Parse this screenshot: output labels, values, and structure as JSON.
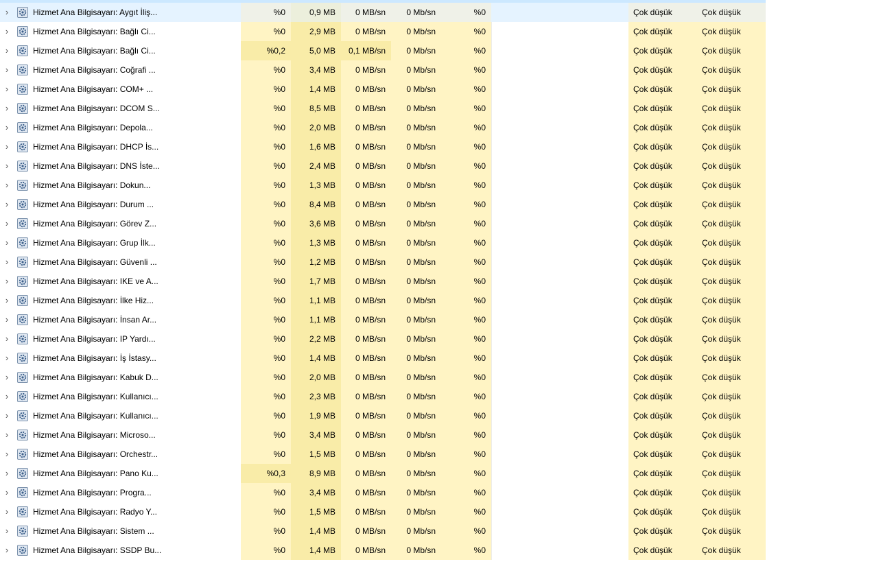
{
  "colors": {
    "accent": "#cce8ff",
    "heat_low": "#fff4c4",
    "heat_mid": "#f9eca8"
  },
  "rows": [
    {
      "name": "Hizmet Ana Bilgisayarı: Aygıt İliş...",
      "cpu": "%0",
      "mem": "0,9 MB",
      "disk": "0 MB/sn",
      "net": "0 Mb/sn",
      "gpu": "%0",
      "power": "Çok düşük",
      "power_trend": "Çok düşük",
      "selected": true
    },
    {
      "name": "Hizmet Ana Bilgisayarı: Bağlı Ci...",
      "cpu": "%0",
      "mem": "2,9 MB",
      "disk": "0 MB/sn",
      "net": "0 Mb/sn",
      "gpu": "%0",
      "power": "Çok düşük",
      "power_trend": "Çok düşük"
    },
    {
      "name": "Hizmet Ana Bilgisayarı: Bağlı Ci...",
      "cpu": "%0,2",
      "mem": "5,0 MB",
      "disk": "0,1 MB/sn",
      "net": "0 Mb/sn",
      "gpu": "%0",
      "power": "Çok düşük",
      "power_trend": "Çok düşük",
      "cpu_hot": true,
      "disk_hot": true
    },
    {
      "name": "Hizmet Ana Bilgisayarı: Coğrafi ...",
      "cpu": "%0",
      "mem": "3,4 MB",
      "disk": "0 MB/sn",
      "net": "0 Mb/sn",
      "gpu": "%0",
      "power": "Çok düşük",
      "power_trend": "Çok düşük"
    },
    {
      "name": "Hizmet Ana Bilgisayarı: COM+ ...",
      "cpu": "%0",
      "mem": "1,4 MB",
      "disk": "0 MB/sn",
      "net": "0 Mb/sn",
      "gpu": "%0",
      "power": "Çok düşük",
      "power_trend": "Çok düşük"
    },
    {
      "name": "Hizmet Ana Bilgisayarı: DCOM S...",
      "cpu": "%0",
      "mem": "8,5 MB",
      "disk": "0 MB/sn",
      "net": "0 Mb/sn",
      "gpu": "%0",
      "power": "Çok düşük",
      "power_trend": "Çok düşük"
    },
    {
      "name": "Hizmet Ana Bilgisayarı: Depola...",
      "cpu": "%0",
      "mem": "2,0 MB",
      "disk": "0 MB/sn",
      "net": "0 Mb/sn",
      "gpu": "%0",
      "power": "Çok düşük",
      "power_trend": "Çok düşük"
    },
    {
      "name": "Hizmet Ana Bilgisayarı: DHCP İs...",
      "cpu": "%0",
      "mem": "1,6 MB",
      "disk": "0 MB/sn",
      "net": "0 Mb/sn",
      "gpu": "%0",
      "power": "Çok düşük",
      "power_trend": "Çok düşük"
    },
    {
      "name": "Hizmet Ana Bilgisayarı: DNS İste...",
      "cpu": "%0",
      "mem": "2,4 MB",
      "disk": "0 MB/sn",
      "net": "0 Mb/sn",
      "gpu": "%0",
      "power": "Çok düşük",
      "power_trend": "Çok düşük"
    },
    {
      "name": "Hizmet Ana Bilgisayarı: Dokun...",
      "cpu": "%0",
      "mem": "1,3 MB",
      "disk": "0 MB/sn",
      "net": "0 Mb/sn",
      "gpu": "%0",
      "power": "Çok düşük",
      "power_trend": "Çok düşük"
    },
    {
      "name": "Hizmet Ana Bilgisayarı: Durum ...",
      "cpu": "%0",
      "mem": "8,4 MB",
      "disk": "0 MB/sn",
      "net": "0 Mb/sn",
      "gpu": "%0",
      "power": "Çok düşük",
      "power_trend": "Çok düşük"
    },
    {
      "name": "Hizmet Ana Bilgisayarı: Görev Z...",
      "cpu": "%0",
      "mem": "3,6 MB",
      "disk": "0 MB/sn",
      "net": "0 Mb/sn",
      "gpu": "%0",
      "power": "Çok düşük",
      "power_trend": "Çok düşük"
    },
    {
      "name": "Hizmet Ana Bilgisayarı: Grup İlk...",
      "cpu": "%0",
      "mem": "1,3 MB",
      "disk": "0 MB/sn",
      "net": "0 Mb/sn",
      "gpu": "%0",
      "power": "Çok düşük",
      "power_trend": "Çok düşük"
    },
    {
      "name": "Hizmet Ana Bilgisayarı: Güvenli ...",
      "cpu": "%0",
      "mem": "1,2 MB",
      "disk": "0 MB/sn",
      "net": "0 Mb/sn",
      "gpu": "%0",
      "power": "Çok düşük",
      "power_trend": "Çok düşük"
    },
    {
      "name": "Hizmet Ana Bilgisayarı: IKE ve A...",
      "cpu": "%0",
      "mem": "1,7 MB",
      "disk": "0 MB/sn",
      "net": "0 Mb/sn",
      "gpu": "%0",
      "power": "Çok düşük",
      "power_trend": "Çok düşük"
    },
    {
      "name": "Hizmet Ana Bilgisayarı: İlke Hiz...",
      "cpu": "%0",
      "mem": "1,1 MB",
      "disk": "0 MB/sn",
      "net": "0 Mb/sn",
      "gpu": "%0",
      "power": "Çok düşük",
      "power_trend": "Çok düşük"
    },
    {
      "name": "Hizmet Ana Bilgisayarı: İnsan Ar...",
      "cpu": "%0",
      "mem": "1,1 MB",
      "disk": "0 MB/sn",
      "net": "0 Mb/sn",
      "gpu": "%0",
      "power": "Çok düşük",
      "power_trend": "Çok düşük"
    },
    {
      "name": "Hizmet Ana Bilgisayarı: IP Yardı...",
      "cpu": "%0",
      "mem": "2,2 MB",
      "disk": "0 MB/sn",
      "net": "0 Mb/sn",
      "gpu": "%0",
      "power": "Çok düşük",
      "power_trend": "Çok düşük"
    },
    {
      "name": "Hizmet Ana Bilgisayarı: İş İstasy...",
      "cpu": "%0",
      "mem": "1,4 MB",
      "disk": "0 MB/sn",
      "net": "0 Mb/sn",
      "gpu": "%0",
      "power": "Çok düşük",
      "power_trend": "Çok düşük"
    },
    {
      "name": "Hizmet Ana Bilgisayarı: Kabuk D...",
      "cpu": "%0",
      "mem": "2,0 MB",
      "disk": "0 MB/sn",
      "net": "0 Mb/sn",
      "gpu": "%0",
      "power": "Çok düşük",
      "power_trend": "Çok düşük"
    },
    {
      "name": "Hizmet Ana Bilgisayarı: Kullanıcı...",
      "cpu": "%0",
      "mem": "2,3 MB",
      "disk": "0 MB/sn",
      "net": "0 Mb/sn",
      "gpu": "%0",
      "power": "Çok düşük",
      "power_trend": "Çok düşük"
    },
    {
      "name": "Hizmet Ana Bilgisayarı: Kullanıcı...",
      "cpu": "%0",
      "mem": "1,9 MB",
      "disk": "0 MB/sn",
      "net": "0 Mb/sn",
      "gpu": "%0",
      "power": "Çok düşük",
      "power_trend": "Çok düşük"
    },
    {
      "name": "Hizmet Ana Bilgisayarı: Microso...",
      "cpu": "%0",
      "mem": "3,4 MB",
      "disk": "0 MB/sn",
      "net": "0 Mb/sn",
      "gpu": "%0",
      "power": "Çok düşük",
      "power_trend": "Çok düşük"
    },
    {
      "name": "Hizmet Ana Bilgisayarı: Orchestr...",
      "cpu": "%0",
      "mem": "1,5 MB",
      "disk": "0 MB/sn",
      "net": "0 Mb/sn",
      "gpu": "%0",
      "power": "Çok düşük",
      "power_trend": "Çok düşük"
    },
    {
      "name": "Hizmet Ana Bilgisayarı: Pano Ku...",
      "cpu": "%0,3",
      "mem": "8,9 MB",
      "disk": "0 MB/sn",
      "net": "0 Mb/sn",
      "gpu": "%0",
      "power": "Çok düşük",
      "power_trend": "Çok düşük",
      "cpu_hot": true
    },
    {
      "name": "Hizmet Ana Bilgisayarı: Progra...",
      "cpu": "%0",
      "mem": "3,4 MB",
      "disk": "0 MB/sn",
      "net": "0 Mb/sn",
      "gpu": "%0",
      "power": "Çok düşük",
      "power_trend": "Çok düşük"
    },
    {
      "name": "Hizmet Ana Bilgisayarı: Radyo Y...",
      "cpu": "%0",
      "mem": "1,5 MB",
      "disk": "0 MB/sn",
      "net": "0 Mb/sn",
      "gpu": "%0",
      "power": "Çok düşük",
      "power_trend": "Çok düşük"
    },
    {
      "name": "Hizmet Ana Bilgisayarı: Sistem ...",
      "cpu": "%0",
      "mem": "1,4 MB",
      "disk": "0 MB/sn",
      "net": "0 Mb/sn",
      "gpu": "%0",
      "power": "Çok düşük",
      "power_trend": "Çok düşük"
    },
    {
      "name": "Hizmet Ana Bilgisayarı: SSDP Bu...",
      "cpu": "%0",
      "mem": "1,4 MB",
      "disk": "0 MB/sn",
      "net": "0 Mb/sn",
      "gpu": "%0",
      "power": "Çok düşük",
      "power_trend": "Çok düşük"
    }
  ]
}
